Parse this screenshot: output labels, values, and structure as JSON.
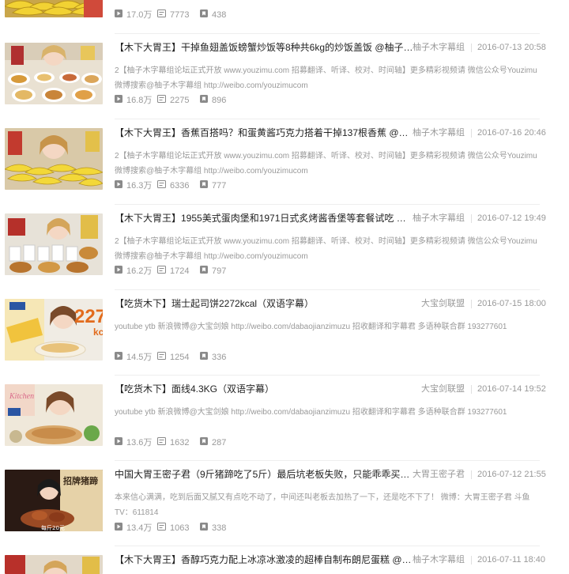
{
  "videos": [
    {
      "title": "",
      "author": "",
      "date": "",
      "desc": "",
      "plays": "17.0万",
      "danmaku": "7773",
      "favorites": "438",
      "theme": "banana"
    },
    {
      "title": "【木下大胃王】干掉鱼翅盖饭螃蟹炒饭等8种共6kg的炒饭盖饭 @柚子木字幕...",
      "author": "柚子木字幕组",
      "date": "2016-07-13 20:58",
      "desc": "2【柚子木字幕组论坛正式开放 www.youzimu.com 招募翻译、听译、校对、时间轴】更多精彩视频请 微信公众号Youzimu 微博搜索@柚子木字幕组 http://weibo.com/youzimucom",
      "plays": "16.8万",
      "danmaku": "2275",
      "favorites": "896",
      "theme": "rice"
    },
    {
      "title": "【木下大胃王】香蕉百搭吗？和蛋黄酱巧克力搭着干掉137根香蕉 @柚子木...",
      "author": "柚子木字幕组",
      "date": "2016-07-16 20:46",
      "desc": "2【柚子木字幕组论坛正式开放 www.youzimu.com 招募翻译、听译、校对、时间轴】更多精彩视频请 微信公众号Youzimu 微博搜索@柚子木字幕组 http://weibo.com/youzimucom",
      "plays": "16.3万",
      "danmaku": "6336",
      "favorites": "777",
      "theme": "banana"
    },
    {
      "title": "【木下大胃王】1955美式蛋肉堡和1971日式炙烤酱香堡等套餐试吃 @柚子...",
      "author": "柚子木字幕组",
      "date": "2016-07-12 19:49",
      "desc": "2【柚子木字幕组论坛正式开放 www.youzimu.com 招募翻译、听译、校对、时间轴】更多精彩视频请 微信公众号Youzimu 微博搜索@柚子木字幕组 http://weibo.com/youzimucom",
      "plays": "16.2万",
      "danmaku": "1724",
      "favorites": "797",
      "theme": "burger"
    },
    {
      "title": "【吃货木下】瑞士起司饼2272kcal（双语字幕）",
      "author": "大宝剑联盟",
      "date": "2016-07-15 18:00",
      "desc": "youtube ytb 新浪微博@大宝剑娘 http://weibo.com/dabaojianzimuzu 招收翻译和字幕君 多语种联合群 193277601",
      "plays": "14.5万",
      "danmaku": "1254",
      "favorites": "336",
      "theme": "cheese",
      "thumb_text": "227",
      "thumb_sub": "kc"
    },
    {
      "title": "【吃货木下】面线4.3KG（双语字幕）",
      "author": "大宝剑联盟",
      "date": "2016-07-14 19:52",
      "desc": "youtube ytb 新浪微博@大宝剑娘 http://weibo.com/dabaojianzimuzu 招收翻译和字幕君 多语种联合群 193277601",
      "plays": "13.6万",
      "danmaku": "1632",
      "favorites": "287",
      "theme": "noodle",
      "thumb_text": "Kitchen"
    },
    {
      "title": "中国大胃王密子君（9斤猪蹄吃了5斤）最后坑老板失败，只能乖乖买单，好...",
      "author": "大胃王密子君",
      "date": "2016-07-12 21:55",
      "desc": "本来信心满满，吃到后面又腻又有点吃不动了，中间还叫老板去加热了一下，还是吃不下了！ 微博：大胃王密子君 斗鱼TV：611814",
      "plays": "13.4万",
      "danmaku": "1063",
      "favorites": "338",
      "theme": "pork",
      "thumb_text": "招牌猪蹄",
      "thumb_sub": "每斤20元"
    },
    {
      "title": "【木下大胃王】香醇巧克力配上冰凉冰激凌的超棒自制布朗尼蛋糕 @柚子木...",
      "author": "柚子木字幕组",
      "date": "2016-07-11 18:40",
      "desc": "",
      "plays": "",
      "danmaku": "",
      "favorites": "",
      "theme": "brownie"
    }
  ],
  "colors": {
    "title": "#222222",
    "meta": "#999999",
    "divider": "#eeeeee",
    "icon": "#8a8a8a"
  },
  "icons": {
    "plays": "play-icon",
    "danmaku": "danmaku-icon",
    "favorites": "favorite-icon"
  }
}
